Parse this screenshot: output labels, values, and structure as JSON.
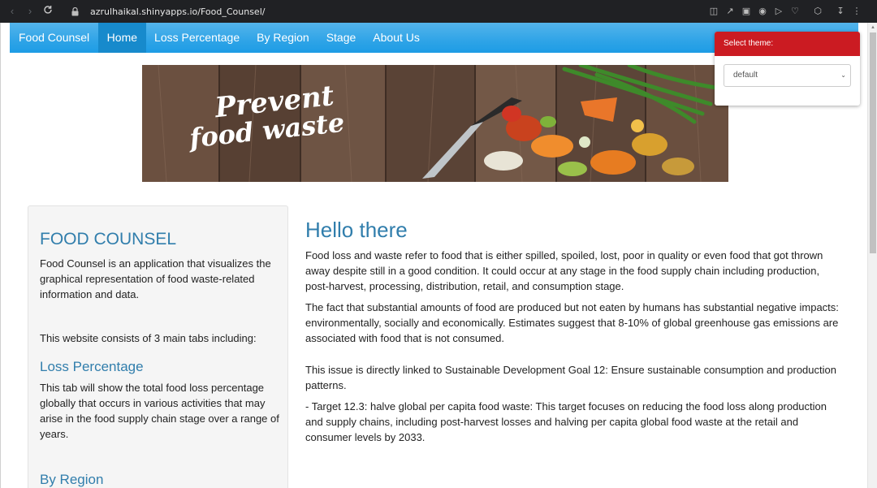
{
  "browser": {
    "url": "azrulhaikal.shinyapps.io/Food_Counsel/",
    "back_icon": "back-arrow-icon",
    "forward_icon": "forward-arrow-icon",
    "reload_icon": "reload-icon"
  },
  "navbar": {
    "brand": "Food Counsel",
    "items": [
      {
        "label": "Home",
        "active": true
      },
      {
        "label": "Loss Percentage",
        "active": false
      },
      {
        "label": "By Region",
        "active": false
      },
      {
        "label": "Stage",
        "active": false
      },
      {
        "label": "About Us",
        "active": false
      }
    ],
    "color": "#2fa4e7",
    "active_color": "#178acc"
  },
  "theme_selector": {
    "label": "Select theme:",
    "value": "default",
    "header_color": "#cb1b22"
  },
  "banner": {
    "text_line1": "Prevent",
    "text_line2": "food waste"
  },
  "sidebar": {
    "title": "FOOD COUNSEL",
    "intro": "Food Counsel is an application that visualizes the graphical representation of food waste-related information and data.",
    "tabs_intro": "This website consists of 3 main tabs including:",
    "section1_heading": "Loss Percentage",
    "section1_text": "This tab will show the total food loss percentage globally that occurs in various activities that may arise in the food supply chain stage over a range of years.",
    "section2_heading": "By Region"
  },
  "main": {
    "title": "Hello there",
    "p1": "Food loss and waste refer to food that is either spilled, spoiled, lost, poor in quality or even food that got thrown away despite still in a good condition. It could occur at any stage in the food supply chain including production, post-harvest, processing, distribution, retail, and consumption stage.",
    "p2": "The fact that substantial amounts of food are produced but not eaten by humans has substantial negative impacts: environmentally, socially and economically. Estimates suggest that 8-10% of global greenhouse gas emissions are associated with food that is not consumed.",
    "p3": "This issue is directly linked to Sustainable Development Goal 12: Ensure sustainable consumption and production patterns.",
    "p4": "- Target 12.3: halve global per capita food waste: This target focuses on reducing the food loss along production and supply chains, including post-harvest losses and halving per capita global food waste at the retail and consumer levels by 2033."
  }
}
